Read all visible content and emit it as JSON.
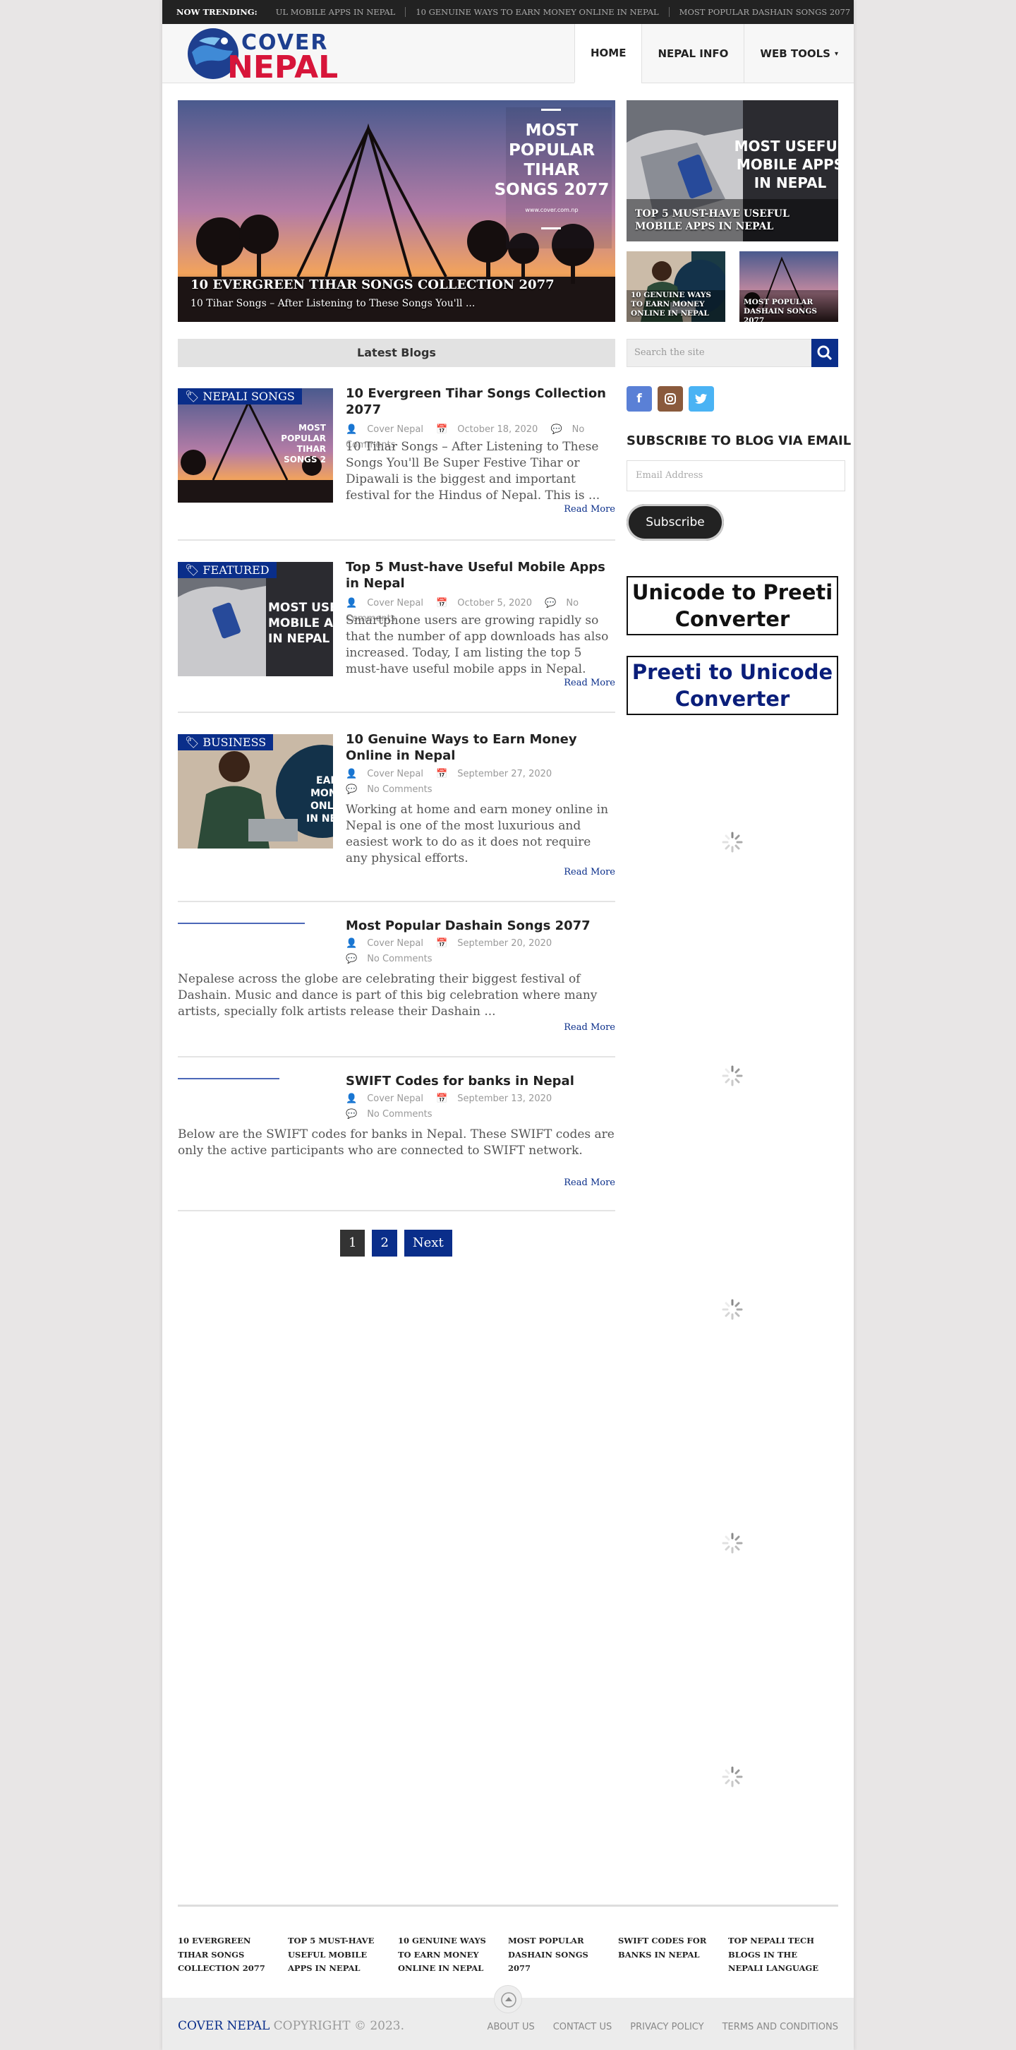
{
  "ticker": {
    "label": "NOW TRENDING:",
    "items": [
      "UL MOBILE APPS IN NEPAL",
      "10 GENUINE WAYS TO EARN MONEY ONLINE IN NEPAL",
      "MOST POPULAR DASHAIN SONGS 2077"
    ]
  },
  "logo": {
    "word1": "COVER",
    "word2": "NEPAL"
  },
  "nav": {
    "home": "HOME",
    "nepal_info": "NEPAL INFO",
    "web_tools": "WEB TOOLS",
    "caret": "▾"
  },
  "hero": {
    "image_text": [
      "MOST",
      "POPULAR",
      "TIHAR",
      "SONGS 2077"
    ],
    "image_url": "www.cover.com.np",
    "title": "10 EVERGREEN TIHAR SONGS COLLECTION 2077",
    "excerpt": "10 Tihar Songs – After Listening to These Songs You'll ..."
  },
  "featured": {
    "big": {
      "image_text": [
        "MOST USEFUL",
        "MOBILE APPS",
        "IN NEPAL"
      ],
      "caption": "TOP 5 MUST-HAVE USEFUL MOBILE APPS IN NEPAL"
    },
    "small1": {
      "caption": "10 GENUINE WAYS TO EARN MONEY ONLINE IN NEPAL"
    },
    "small2": {
      "caption": "MOST POPULAR DASHAIN SONGS 2077"
    }
  },
  "latest_heading": "Latest Blogs",
  "posts": [
    {
      "badge": "NEPALI SONGS",
      "title": "10 Evergreen Tihar Songs Collection 2077",
      "author": "Cover Nepal",
      "date": "October 18, 2020",
      "comments": "No Comments",
      "excerpt": "10 Tihar Songs – After Listening to These Songs You'll Be Super Festive Tihar or Dipawali is the biggest and important festival for the Hindus of Nepal. This is ...",
      "read_more": "Read More"
    },
    {
      "badge": "FEATURED",
      "title": "Top 5 Must-have Useful Mobile Apps in Nepal",
      "author": "Cover Nepal",
      "date": "October 5, 2020",
      "comments": "No Comments",
      "excerpt": "Smartphone users are growing rapidly so that the number of app downloads has also increased. Today, I am listing the top 5 must-have useful mobile apps in Nepal.",
      "read_more": "Read More"
    },
    {
      "badge": "BUSINESS",
      "title": "10 Genuine Ways to Earn Money Online in Nepal",
      "author": "Cover Nepal",
      "date": "September 27, 2020",
      "comments": "No Comments",
      "excerpt": "Working at home and earn money online in Nepal is one of the most luxurious and easiest work to do as it does not require any physical efforts.",
      "read_more": "Read More"
    },
    {
      "title": "Most Popular Dashain Songs 2077",
      "author": "Cover Nepal",
      "date": "September 20, 2020",
      "comments": "No Comments",
      "excerpt": "Nepalese across the globe are celebrating their biggest festival of Dashain. Music and dance is part of this big celebration where many artists, specially folk artists release their Dashain ...",
      "read_more": "Read More"
    },
    {
      "title": "SWIFT Codes for banks in Nepal",
      "author": "Cover Nepal",
      "date": "September 13, 2020",
      "comments": "No Comments",
      "excerpt": "Below are the SWIFT codes for banks in Nepal. These SWIFT codes are only the active participants who are connected to SWIFT network.",
      "read_more": "Read More"
    }
  ],
  "pagination": {
    "p1": "1",
    "p2": "2",
    "next": "Next"
  },
  "sidebar": {
    "search_placeholder": "Search the site",
    "subscribe_heading": "SUBSCRIBE TO BLOG VIA EMAIL",
    "email_placeholder": "Email Address",
    "subscribe_button": "Subscribe",
    "banner1": [
      "Unicode to Preeti",
      "Converter"
    ],
    "banner2": [
      "Preeti to Unicode",
      "Converter"
    ]
  },
  "footer_links": [
    "10 EVERGREEN TIHAR SONGS COLLECTION 2077",
    "TOP 5 MUST-HAVE USEFUL MOBILE APPS IN NEPAL",
    "10 GENUINE WAYS TO EARN MONEY ONLINE IN NEPAL",
    "MOST POPULAR DASHAIN SONGS 2077",
    "SWIFT CODES FOR BANKS IN NEPAL",
    "TOP NEPALI TECH BLOGS IN THE NEPALI LANGUAGE"
  ],
  "footer": {
    "brand": "COVER NEPAL",
    "copyright": "COPYRIGHT © 2023.",
    "menu": [
      "ABOUT US",
      "CONTACT US",
      "PRIVACY POLICY",
      "TERMS AND CONDITIONS"
    ]
  },
  "colors": {
    "accent": "#0a2e8a",
    "logo_red": "#d7153a",
    "facebook": "#5a80d6",
    "instagram": "#8a5a3c",
    "twitter": "#4ab3f4"
  }
}
